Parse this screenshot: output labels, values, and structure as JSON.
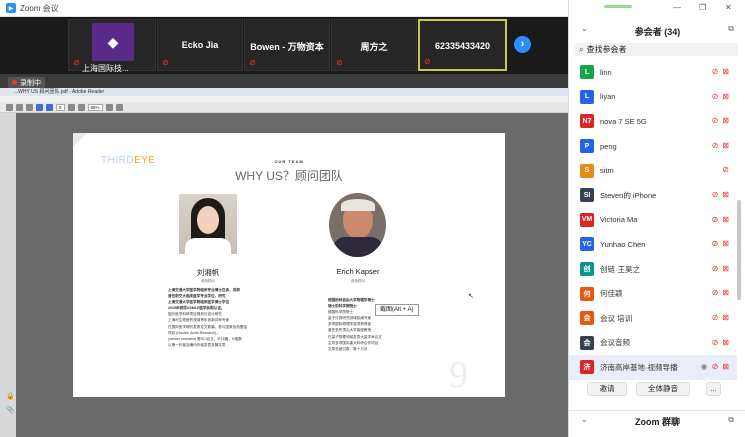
{
  "window": {
    "title": "Zoom 会议"
  },
  "video_strip": {
    "tiles": [
      {
        "name": "上海国际技..."
      },
      {
        "name": "Ecko Jia"
      },
      {
        "name": "Bowen - 万物资本"
      },
      {
        "name": "周方之"
      },
      {
        "name": "62335433420"
      }
    ],
    "next_icon": "chevron-right-icon"
  },
  "share": {
    "record_label": "录制中",
    "reader_title": "...WHY US 顾问团队.pdf - Adobe Reader",
    "zoom_level": "85%",
    "page_current": "9",
    "pdf": {
      "brand_part1": "THIRD",
      "brand_part2": "EYE",
      "section_label": "OUR TEAM",
      "heading": "WHY US？顾问团队",
      "page_number": "9",
      "person1": {
        "name": "刘湘帆",
        "title": "首席顾问",
        "bio": [
          "上海交通大学医学院临床专业博士在读，讲师",
          "曾任职交大临床医学专业学位，研究",
          "上海交通大学医学院临床医学博士学位",
          "2015年获得USMLE医学执照认证。",
          "擅长医学科研项目规划与设计研究",
          "上海市生物医药领域青年创新评审专家",
          "在国际医学期刊发表论文数篇，参与国家自然基金",
          "项目 (Nucleic Acids Research)，",
          "(cancer research) 等SCI论文，IF16篇，H指数",
          "以第一作者及通讯作者发表多篇文章"
        ]
      },
      "person2": {
        "name": "Erich Kapser",
        "title": "首席顾问",
        "bio": [
          "德国柏林自由大学物理学博士",
          "瑞士前科学院院士",
          "德国科学院院士",
          "量子计算研究领域权威专家",
          "多项国际物理学奖项获得者",
          "曾任多所顶尖大学客座教授",
          "在量子物理领域发表大量学术论文",
          "主导多项国际重大科研合作项目",
          "文章总被引数：数十万次"
        ]
      },
      "tooltip": "截图(Alt + A)"
    }
  },
  "panel": {
    "header_title": "参会者 (34)",
    "search_placeholder": "查找参会者",
    "participants": [
      {
        "initials": "L",
        "name": "linn",
        "color": "#16a34a",
        "icons": [
          "mic-muted-icon",
          "video-off-icon"
        ]
      },
      {
        "initials": "L",
        "name": "liyan",
        "color": "#2563eb",
        "icons": [
          "mic-muted-icon",
          "video-off-icon"
        ]
      },
      {
        "initials": "N7",
        "name": "nova 7 SE 5G",
        "color": "#dc2626",
        "icons": [
          "mic-muted-icon",
          "video-off-icon"
        ]
      },
      {
        "initials": "P",
        "name": "peng",
        "color": "#2563eb",
        "icons": [
          "mic-muted-icon",
          "video-off-icon"
        ]
      },
      {
        "initials": "S",
        "name": "sitm",
        "color": "#ea8a1a",
        "icons": [
          "mic-muted-icon"
        ]
      },
      {
        "initials": "SI",
        "name": "Steven的 iPhone",
        "color": "#374151",
        "icons": [
          "mic-muted-icon",
          "video-off-icon"
        ]
      },
      {
        "initials": "VM",
        "name": "Victoria Ma",
        "color": "#dc2626",
        "icons": [
          "mic-muted-icon",
          "video-off-icon"
        ]
      },
      {
        "initials": "YC",
        "name": "Yunhao Chen",
        "color": "#2563eb",
        "icons": [
          "mic-muted-icon",
          "video-off-icon"
        ]
      },
      {
        "initials": "创",
        "name": "创链·王昊之",
        "color": "#0d9488",
        "icons": [
          "mic-muted-icon",
          "video-off-icon"
        ]
      },
      {
        "initials": "何",
        "name": "何佳颖",
        "color": "#ea580c",
        "icons": [
          "mic-muted-icon",
          "video-off-icon"
        ]
      },
      {
        "initials": "会",
        "name": "会议 培训",
        "color": "#ea580c",
        "icons": [
          "mic-muted-icon",
          "video-off-icon"
        ]
      },
      {
        "initials": "会",
        "name": "会议音频",
        "color": "#374151",
        "icons": [
          "mic-muted-icon",
          "video-off-icon"
        ]
      },
      {
        "initials": "济",
        "name": "济南高岸基地·视频导播",
        "color": "#dc2626",
        "icons": [
          "share-icon",
          "mic-muted-icon",
          "video-off-icon"
        ]
      }
    ],
    "actions": {
      "invite": "邀请",
      "mute_all": "全体静音",
      "more": "..."
    },
    "chat_title": "Zoom 群聊"
  }
}
